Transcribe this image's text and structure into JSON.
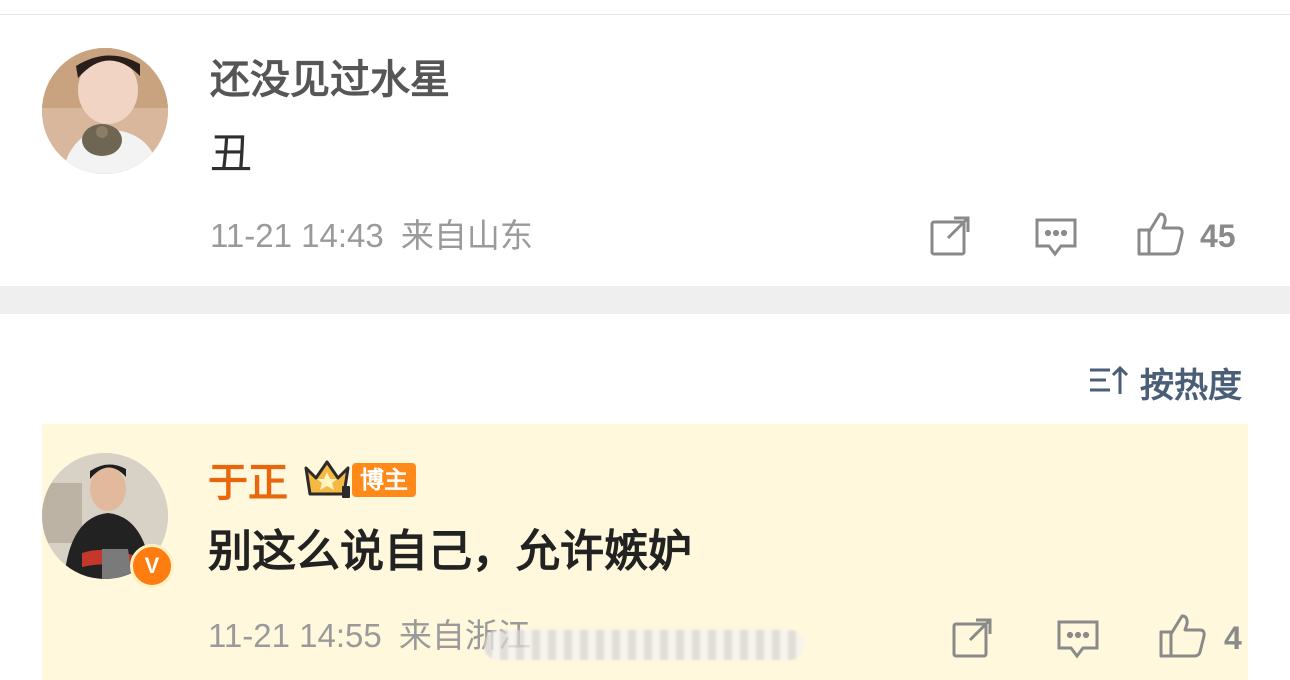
{
  "post": {
    "username": "还没见过水星",
    "content": "丑",
    "timestamp": "11-21 14:43",
    "location": "来自山东",
    "actions": {
      "share_icon": "share-icon",
      "comment_icon": "comment-icon",
      "like_icon": "thumbs-up-icon",
      "like_count": "45"
    }
  },
  "sort": {
    "icon": "sort-icon",
    "label": "按热度"
  },
  "comment": {
    "username": "于正",
    "crown_icon": "crown-icon",
    "badge": "博主",
    "verified_icon": "verified-v-icon",
    "verified_letter": "V",
    "content": "别这么说自己，允许嫉妒",
    "timestamp": "11-21 14:55",
    "location": "来自浙江",
    "actions": {
      "share_icon": "share-icon",
      "comment_icon": "comment-icon",
      "like_icon": "thumbs-up-icon",
      "like_count": "4"
    }
  },
  "colors": {
    "comment_highlight_bg": "#fff8dc",
    "username_orange": "#e8660c",
    "badge_orange": "#ff8a1a",
    "sort_blue": "#4a5e78",
    "meta_gray": "#9a9a9a"
  }
}
